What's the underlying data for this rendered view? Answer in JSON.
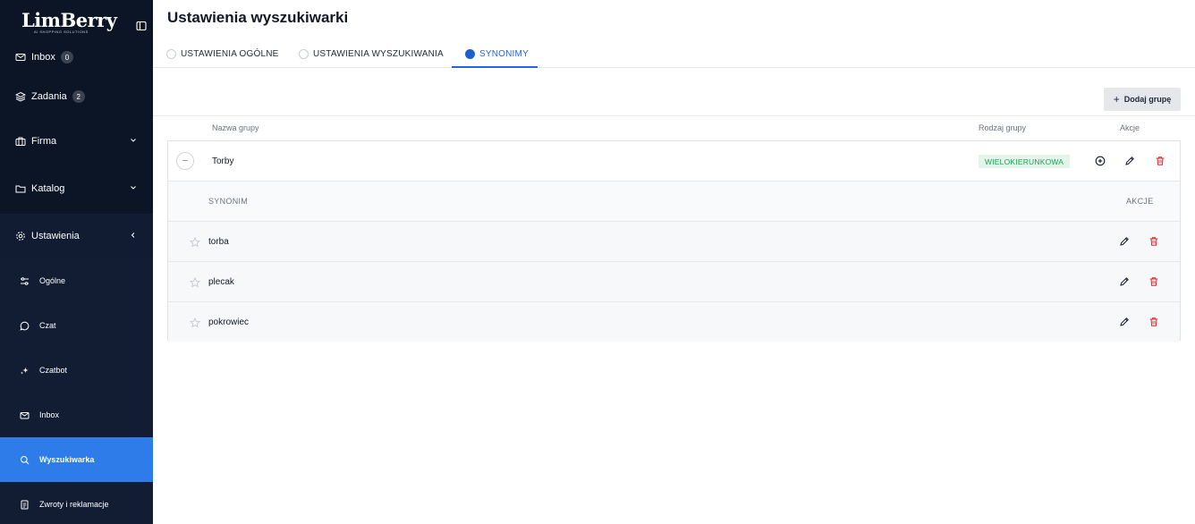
{
  "brand": {
    "logo_text": "LimBerry",
    "logo_sub": "AI SHOPPING SOLUTIONS"
  },
  "sidebar": {
    "items": [
      {
        "label": "Inbox",
        "badge": "0",
        "icon": "mail-icon"
      },
      {
        "label": "Zadania",
        "badge": "2",
        "icon": "layers-icon"
      },
      {
        "label": "Firma",
        "icon": "briefcase-icon",
        "chevron": "down"
      },
      {
        "label": "Katalog",
        "icon": "folder-icon",
        "chevron": "down"
      },
      {
        "label": "Ustawienia",
        "icon": "gear-icon",
        "chevron": "left"
      }
    ],
    "sub_items": [
      {
        "label": "Ogólne",
        "icon": "sliders-icon"
      },
      {
        "label": "Czat",
        "icon": "chat-icon"
      },
      {
        "label": "Czatbot",
        "icon": "sparkles-icon"
      },
      {
        "label": "Inbox",
        "icon": "mail-icon"
      },
      {
        "label": "Wyszukiwarka",
        "icon": "search-icon",
        "active": true
      },
      {
        "label": "Zwroty i reklamacje",
        "icon": "document-icon"
      }
    ]
  },
  "page": {
    "title": "Ustawienia wyszukiwarki"
  },
  "tabs": [
    {
      "label": "USTAWIENIA OGÓLNE",
      "active": false
    },
    {
      "label": "USTAWIENIA WYSZUKIWANIA",
      "active": false
    },
    {
      "label": "SYNONIMY",
      "active": true
    }
  ],
  "toolbar": {
    "add_group_label": "Dodaj grupę"
  },
  "table": {
    "col_name": "Nazwa grupy",
    "col_type": "Rodzaj grupy",
    "col_actions": "Akcje",
    "group": {
      "name": "Torby",
      "type": "WIELOKIERUNKOWA",
      "synonym_col": "SYNONIM",
      "actions_col": "AKCJE",
      "synonyms": [
        "torba",
        "plecak",
        "pokrowiec"
      ]
    }
  },
  "colors": {
    "sidebar_bg": "#0e1a2e",
    "active_item": "#2e7ce9",
    "accent": "#2563eb",
    "badge_green_bg": "#e3f5ea",
    "badge_green_text": "#1f9d55",
    "delete_red": "#dc2626"
  }
}
